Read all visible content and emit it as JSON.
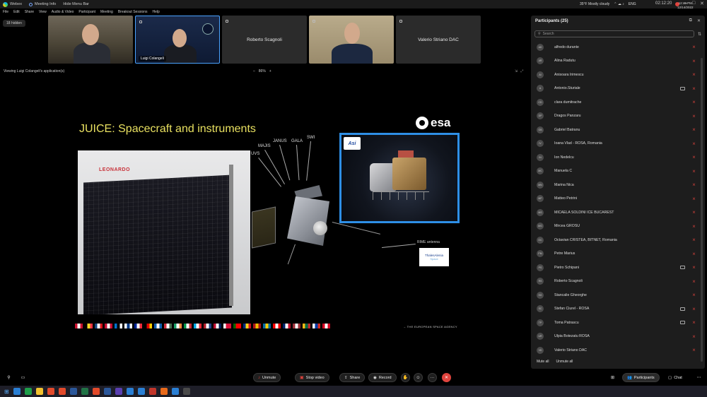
{
  "titlebar": {
    "app_name": "Webex",
    "meeting_info": "Meeting Info",
    "hide_menu_bar": "Hide Menu Bar",
    "clock": "02:12:20",
    "minimize": "–",
    "maximize": "□",
    "close": "✕"
  },
  "menu": [
    "File",
    "Edit",
    "Share",
    "View",
    "Audio & Video",
    "Participant",
    "Meeting",
    "Breakout Sessions",
    "Help"
  ],
  "hidden_count": "18 hidden",
  "tiles": [
    {
      "name": "",
      "type": "video"
    },
    {
      "name": "Luigi Colangeli",
      "type": "video",
      "active": true
    },
    {
      "name": "Roberto Scagnoli",
      "type": "namecard"
    },
    {
      "name": "",
      "type": "video"
    },
    {
      "name": "Valerio Striano DAC",
      "type": "namecard"
    }
  ],
  "viewing": {
    "label": "Viewing Luigi Colangeli's application(s)",
    "zoom_minus": "–",
    "zoom": "86%",
    "zoom_plus": "+"
  },
  "slide": {
    "title": "JUICE: Spacecraft and instruments",
    "esa_logo": "esa",
    "leonardo": "LEONARDO",
    "asi_logo": "Asi",
    "instruments": [
      "UVS",
      "MAJIS",
      "JANUS",
      "GALA",
      "SWI"
    ],
    "rime_label": "RIME antenna",
    "thales_line1": "ThalesAlenia",
    "thales_line2": "Space",
    "agency": "→ THE EUROPEAN SPACE AGENCY",
    "flag_colors": [
      [
        "#c8102e",
        "#ffffff",
        "#c8102e"
      ],
      [
        "#000000",
        "#fdda24",
        "#ef3340"
      ],
      [
        "#11457e",
        "#ffffff",
        "#d7141a"
      ],
      [
        "#c60c30",
        "#ffffff",
        "#c60c30"
      ],
      [
        "#0072ce",
        "#000000",
        "#ffffff"
      ],
      [
        "#ffffff",
        "#003580",
        "#ffffff"
      ],
      [
        "#002395",
        "#ffffff",
        "#ed2939"
      ],
      [
        "#000000",
        "#dd0000",
        "#ffce00"
      ],
      [
        "#0d5eaf",
        "#ffffff",
        "#0d5eaf"
      ],
      [
        "#ce2939",
        "#ffffff",
        "#477050"
      ],
      [
        "#169b62",
        "#ffffff",
        "#ff883e"
      ],
      [
        "#009246",
        "#ffffff",
        "#ce2b37"
      ],
      [
        "#00a3e0",
        "#ffffff",
        "#ed2939"
      ],
      [
        "#ae1c28",
        "#ffffff",
        "#21468b"
      ],
      [
        "#ba0c2f",
        "#ffffff",
        "#00205b"
      ],
      [
        "#ffffff",
        "#dc143c",
        "#dc143c"
      ],
      [
        "#006600",
        "#ff0000",
        "#ff0000"
      ],
      [
        "#002b7f",
        "#fcd116",
        "#ce1126"
      ],
      [
        "#aa151b",
        "#f1bf00",
        "#aa151b"
      ],
      [
        "#006aa7",
        "#fecc00",
        "#006aa7"
      ],
      [
        "#ff0000",
        "#ffffff",
        "#ff0000"
      ],
      [
        "#012169",
        "#ffffff",
        "#c8102e"
      ],
      [
        "#9e3039",
        "#ffffff",
        "#9e3039"
      ],
      [
        "#fdb913",
        "#006a44",
        "#c1272d"
      ],
      [
        "#ffffff",
        "#0039a6",
        "#d52b1e"
      ],
      [
        "#d80621",
        "#ffffff",
        "#d80621"
      ]
    ]
  },
  "toolbar": {
    "unmute": "Unmute",
    "stop_video": "Stop video",
    "share": "Share",
    "record": "Record",
    "more": "···",
    "end": "✕",
    "participants": "Participants",
    "chat": "Chat"
  },
  "panel": {
    "title": "Participants (25)",
    "search_placeholder": "Search",
    "mute_all": "Mute all",
    "unmute_all": "Unmute all",
    "participants": [
      {
        "initials": "AD",
        "name": "alfredo durante",
        "video": false
      },
      {
        "initials": "AR",
        "name": "Alina Radutu",
        "video": false
      },
      {
        "initials": "AI",
        "name": "Anisoara Irimescu",
        "video": false
      },
      {
        "initials": "A",
        "name": "Antonio.Sturiale",
        "video": true
      },
      {
        "initials": "CD",
        "name": "clara dumitrache",
        "video": false
      },
      {
        "initials": "DP",
        "name": "Dragos Panzaru",
        "video": false
      },
      {
        "initials": "GB",
        "name": "Gabriel Batranu",
        "video": false
      },
      {
        "initials": "IV",
        "name": "Ioana Vlad - ROSA, Romania",
        "video": false
      },
      {
        "initials": "IN",
        "name": "Ion Nedelcu",
        "video": false
      },
      {
        "initials": "MC",
        "name": "Manuela C",
        "video": false
      },
      {
        "initials": "MN",
        "name": "Marina Nica",
        "video": false
      },
      {
        "initials": "MP",
        "name": "Matteo Petrini",
        "video": false
      },
      {
        "initials": "MS",
        "name": "MICAELA SOLDINI ICE BUCAREST",
        "video": false
      },
      {
        "initials": "MG",
        "name": "Mircea GROSU",
        "video": false
      },
      {
        "initials": "OC",
        "name": "Octavian CRISTEA, BITNET, Romania",
        "video": false
      },
      {
        "initials": "PM",
        "name": "Petre Marius",
        "video": false
      },
      {
        "initials": "PS",
        "name": "Pietro Schipani",
        "video": true
      },
      {
        "initials": "RS",
        "name": "Roberto Scagnoli",
        "video": false
      },
      {
        "initials": "SG",
        "name": "Stancalie Gheorghe",
        "video": false
      },
      {
        "initials": "SC",
        "name": "Stefan Ciurel - ROSA",
        "video": true
      },
      {
        "initials": "TP",
        "name": "Toma Patrascu",
        "video": true
      },
      {
        "initials": "UR",
        "name": "Ulpia Botezatu ROSA",
        "video": false
      },
      {
        "initials": "VD",
        "name": "Valerio Striano DAC",
        "video": false
      }
    ]
  },
  "taskbar": {
    "weather": "35°F  Mostly cloudy",
    "lang": "ENG",
    "time": "12:46 PM",
    "date": "12/14/2022",
    "icon_colors": [
      "#2a7fd4",
      "#1e9e4a",
      "#f2c12e",
      "#e24a2b",
      "#e24a2b",
      "#2b579a",
      "#217346",
      "#e24a2b",
      "#2b579a",
      "#5a3fb0",
      "#2a7fd4",
      "#2a7fd4",
      "#c2362b",
      "#e86a1b",
      "#2a7fd4",
      "#4a4a4a"
    ]
  }
}
